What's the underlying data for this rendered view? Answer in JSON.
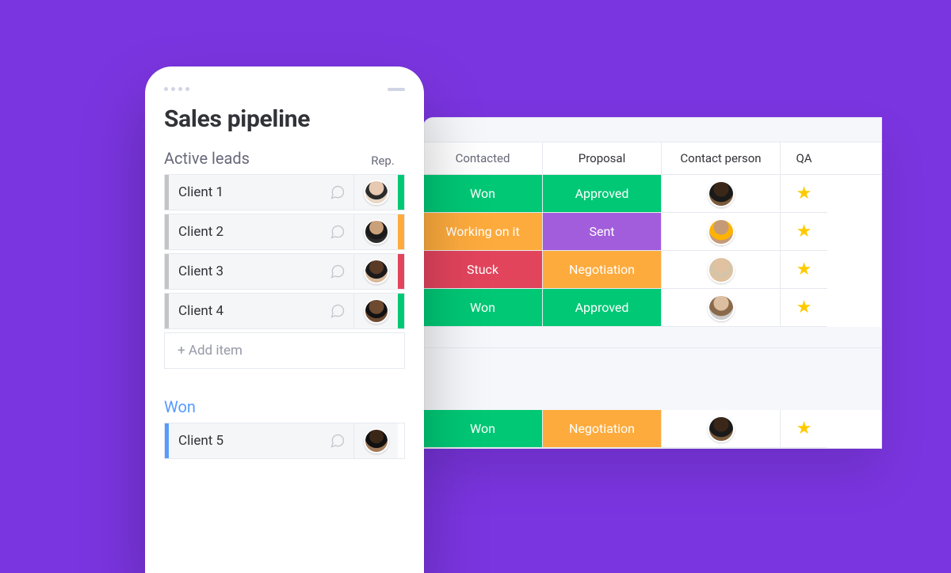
{
  "mobile": {
    "title": "Sales pipeline",
    "group1": {
      "title": "Active leads",
      "col_label": "Rep.",
      "rows": [
        {
          "name": "Client 1",
          "stripe": "green",
          "avatar": "av1"
        },
        {
          "name": "Client 2",
          "stripe": "orange",
          "avatar": "av2"
        },
        {
          "name": "Client 3",
          "stripe": "red",
          "avatar": "av3"
        },
        {
          "name": "Client 4",
          "stripe": "green",
          "avatar": "av4"
        }
      ],
      "add_label": "+ Add item"
    },
    "group2": {
      "title": "Won",
      "rows": [
        {
          "name": "Client 5",
          "stripe": "blue",
          "avatar": "av5"
        }
      ]
    }
  },
  "board": {
    "columns": [
      "Contacted",
      "Proposal",
      "Contact person",
      "QA"
    ],
    "section1": [
      {
        "contacted": {
          "label": "Won",
          "color": "green"
        },
        "proposal": {
          "label": "Approved",
          "color": "green"
        },
        "avatar": "av6",
        "star": true
      },
      {
        "contacted": {
          "label": "Working on it",
          "color": "orange"
        },
        "proposal": {
          "label": "Sent",
          "color": "purple"
        },
        "avatar": "av7",
        "star": true
      },
      {
        "contacted": {
          "label": "Stuck",
          "color": "red"
        },
        "proposal": {
          "label": "Negotiation",
          "color": "orange"
        },
        "avatar": "av8",
        "star": true
      },
      {
        "contacted": {
          "label": "Won",
          "color": "green"
        },
        "proposal": {
          "label": "Approved",
          "color": "green"
        },
        "avatar": "av9",
        "star": true
      }
    ],
    "section2": [
      {
        "contacted": {
          "label": "Won",
          "color": "green"
        },
        "proposal": {
          "label": "Negotiation",
          "color": "orange"
        },
        "avatar": "av6",
        "star": true
      }
    ]
  }
}
